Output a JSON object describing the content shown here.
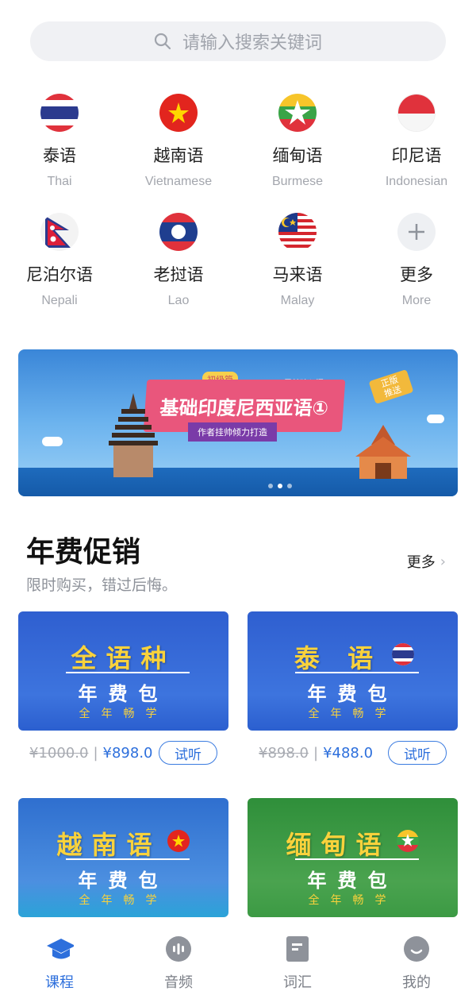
{
  "search": {
    "placeholder": "请输入搜索关键词"
  },
  "languages": [
    {
      "zh": "泰语",
      "en": "Thai",
      "icon": "thailand-flag-icon"
    },
    {
      "zh": "越南语",
      "en": "Vietnamese",
      "icon": "vietnam-flag-icon"
    },
    {
      "zh": "缅甸语",
      "en": "Burmese",
      "icon": "myanmar-flag-icon"
    },
    {
      "zh": "印尼语",
      "en": "Indonesian",
      "icon": "indonesia-flag-icon"
    },
    {
      "zh": "尼泊尔语",
      "en": "Nepali",
      "icon": "nepal-flag-icon"
    },
    {
      "zh": "老挝语",
      "en": "Lao",
      "icon": "laos-flag-icon"
    },
    {
      "zh": "马来语",
      "en": "Malay",
      "icon": "malaysia-flag-icon"
    },
    {
      "zh": "更多",
      "en": "More",
      "icon": "plus-icon"
    }
  ],
  "banner": {
    "tag": "初级篇",
    "zero": "零基础入门",
    "title": "基础印度尼西亚语①",
    "subtitle": "作者挂帅倾力打造",
    "badge_l1": "正版",
    "badge_l2": "推送"
  },
  "section": {
    "title": "年费促销",
    "more": "更多",
    "subtitle": "限时购买，错过后悔。"
  },
  "cards": [
    {
      "t1": "全语种",
      "t2": "年费包",
      "t3": "全年畅学",
      "old": "¥1000.0",
      "new": "¥898.0",
      "listen": "试听"
    },
    {
      "t1": "泰 语",
      "t2": "年费包",
      "t3": "全年畅学",
      "old": "¥898.0",
      "new": "¥488.0",
      "listen": "试听"
    },
    {
      "t1": "越南语",
      "t2": "年费包",
      "t3": "全年畅学"
    },
    {
      "t1": "缅甸语",
      "t2": "年费包",
      "t3": "全年畅学"
    }
  ],
  "price_sep": "|",
  "tabs": [
    {
      "label": "课程",
      "icon": "graduation-cap-icon"
    },
    {
      "label": "音频",
      "icon": "audio-icon"
    },
    {
      "label": "词汇",
      "icon": "vocabulary-icon"
    },
    {
      "label": "我的",
      "icon": "profile-icon"
    }
  ],
  "colors": {
    "accent": "#2d6fdc",
    "card_yellow": "#f9d23c"
  }
}
